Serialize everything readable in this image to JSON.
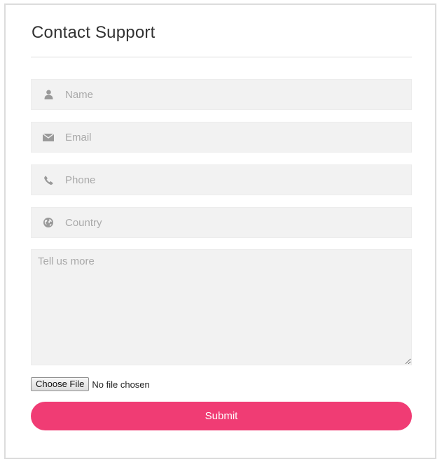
{
  "form": {
    "title": "Contact Support",
    "fields": [
      {
        "placeholder": "Name",
        "icon": "user-icon"
      },
      {
        "placeholder": "Email",
        "icon": "envelope-icon"
      },
      {
        "placeholder": "Phone",
        "icon": "phone-icon"
      },
      {
        "placeholder": "Country",
        "icon": "globe-icon"
      }
    ],
    "message": {
      "placeholder": "Tell us more"
    },
    "file": {
      "button_label": "Choose File",
      "status": "No file chosen"
    },
    "submit_label": "Submit",
    "colors": {
      "accent": "#f03c74",
      "field_background": "#f2f2f2",
      "icon": "#9a9a9a"
    }
  }
}
